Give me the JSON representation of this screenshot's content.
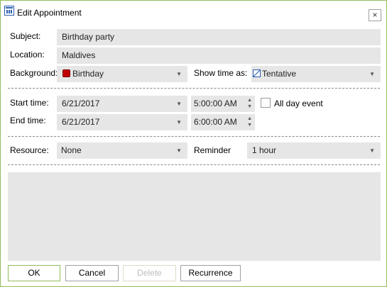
{
  "window": {
    "title": "Edit Appointment",
    "close_glyph": "×"
  },
  "form": {
    "subject": {
      "label": "Subject:",
      "value": "Birthday party"
    },
    "location": {
      "label": "Location:",
      "value": "Maldives"
    },
    "background": {
      "label": "Background:",
      "value": "Birthday",
      "swatch_color": "#c00000"
    },
    "show_time_as": {
      "label": "Show time as:",
      "value": "Tentative"
    },
    "start_time": {
      "label": "Start time:",
      "date": "6/21/2017",
      "time": "5:00:00 AM"
    },
    "end_time": {
      "label": "End time:",
      "date": "6/21/2017",
      "time": "6:00:00 AM"
    },
    "all_day": {
      "label": "All day event",
      "checked": false
    },
    "resource": {
      "label": "Resource:",
      "value": "None"
    },
    "reminder": {
      "label": "Reminder",
      "value": "1 hour"
    },
    "description": ""
  },
  "buttons": {
    "ok": "OK",
    "cancel": "Cancel",
    "delete": "Delete",
    "recurrence": "Recurrence"
  },
  "glyphs": {
    "dropdown": "▼",
    "spin_up": "▲",
    "spin_down": "▼"
  },
  "colors": {
    "accent": "#8fbc5a",
    "field_bg": "#e6e6e6"
  }
}
